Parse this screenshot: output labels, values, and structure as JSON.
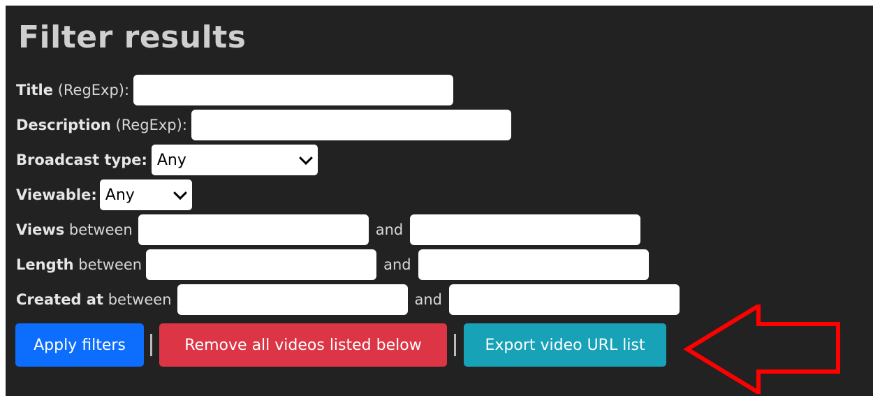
{
  "heading": "Filter results",
  "filters": {
    "title": {
      "bold": "Title",
      "rest": " (RegExp):",
      "value": ""
    },
    "description": {
      "bold": "Description",
      "rest": " (RegExp):",
      "value": ""
    },
    "broadcast_type": {
      "bold": "Broadcast type",
      "rest": ":",
      "selected": "Any"
    },
    "viewable": {
      "bold": "Viewable",
      "rest": ":",
      "selected": "Any"
    },
    "views": {
      "bold": "Views",
      "rest": " between",
      "and": "and",
      "min": "",
      "max": ""
    },
    "length": {
      "bold": "Length",
      "rest": " between",
      "and": "and",
      "min": "",
      "max": ""
    },
    "created_at": {
      "bold": "Created at",
      "rest": " between",
      "and": "and",
      "min": "",
      "max": ""
    }
  },
  "buttons": {
    "apply": "Apply filters",
    "remove_all": "Remove all videos listed below",
    "export": "Export video URL list",
    "separator": "|"
  },
  "colors": {
    "panel_bg": "#222222",
    "apply": "#0d6efd",
    "remove": "#dc3545",
    "export": "#17a2b8",
    "annotation_arrow": "#ff0000"
  }
}
